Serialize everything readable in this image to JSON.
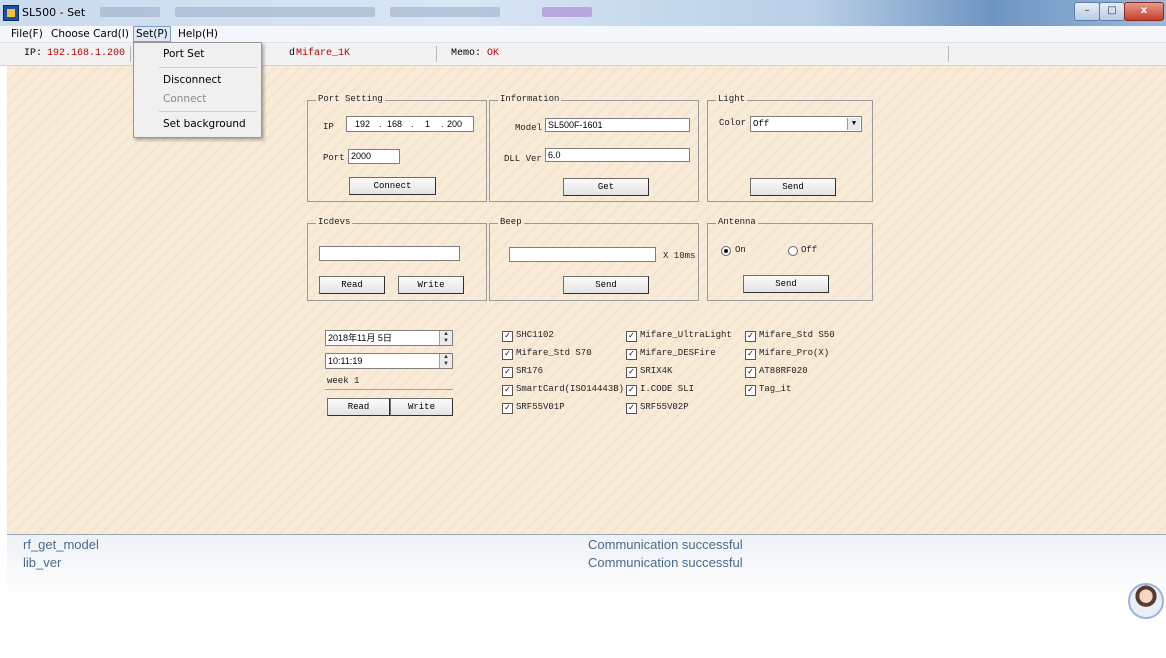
{
  "window": {
    "title": "SL500 - Set",
    "buttons": {
      "minimize": "–",
      "maximize": "□",
      "close": "x"
    }
  },
  "menubar": {
    "items": [
      "File(F)",
      "Choose Card(I)",
      "Set(P)",
      "Help(H)"
    ],
    "active": "Set(P)"
  },
  "set_menu": {
    "items": [
      {
        "label": "Port Set",
        "enabled": true
      },
      {
        "label": "Disconnect",
        "enabled": true
      },
      {
        "label": "Connect",
        "enabled": false
      },
      {
        "label": "Set background",
        "enabled": true
      }
    ]
  },
  "infobar": {
    "ip_label": "IP:",
    "ip_value": "192.168.1.200",
    "card_label": "d",
    "card_value": "Mifare_1K",
    "memo_label": "Memo:",
    "memo_value": "OK"
  },
  "port_setting": {
    "title": "Port Setting",
    "ip_label": "IP",
    "ip": [
      "192",
      "168",
      "1",
      "200"
    ],
    "port_label": "Port",
    "port": "2000",
    "connect_label": "Connect"
  },
  "information": {
    "title": "Information",
    "model_label": "Model",
    "model": "SL500F-1601",
    "dll_label": "DLL Ver",
    "dll": "6.0",
    "get_label": "Get"
  },
  "light": {
    "title": "Light",
    "color_label": "Color",
    "color": "Off",
    "send_label": "Send"
  },
  "icdevs": {
    "title": "Icdevs",
    "value": "",
    "read_label": "Read",
    "write_label": "Write"
  },
  "beep": {
    "title": "Beep",
    "value": "",
    "unit": "X 10ms",
    "send_label": "Send"
  },
  "antenna": {
    "title": "Antenna",
    "on_label": "On",
    "off_label": "Off",
    "selected": "On",
    "send_label": "Send"
  },
  "datetime": {
    "date": "2018年11月 5日",
    "time": "10:11:19",
    "week": "week 1",
    "read_label": "Read",
    "write_label": "Write"
  },
  "card_types": [
    {
      "label": "SHC1102",
      "checked": true
    },
    {
      "label": "Mifare_UltraLight",
      "checked": true
    },
    {
      "label": "Mifare_Std S50",
      "checked": true
    },
    {
      "label": "Mifare_Std S70",
      "checked": true
    },
    {
      "label": "Mifare_DESFire",
      "checked": true
    },
    {
      "label": "Mifare_Pro(X)",
      "checked": true
    },
    {
      "label": "SR176",
      "checked": true
    },
    {
      "label": "SRIX4K",
      "checked": true
    },
    {
      "label": "AT88RF020",
      "checked": true
    },
    {
      "label": "SmartCard(ISO14443B)",
      "checked": true
    },
    {
      "label": "I.CODE SLI",
      "checked": true
    },
    {
      "label": "Tag_it",
      "checked": true
    },
    {
      "label": "SRF55V01P",
      "checked": true
    },
    {
      "label": "SRF55V02P",
      "checked": true
    }
  ],
  "log": [
    {
      "func": "rf_get_model",
      "status": "Communication successful"
    },
    {
      "func": "lib_ver",
      "status": "Communication successful"
    }
  ],
  "colors": {
    "background": "#f8ecd8",
    "value_red": "#c00000",
    "log_text": "#4a6a8a"
  }
}
